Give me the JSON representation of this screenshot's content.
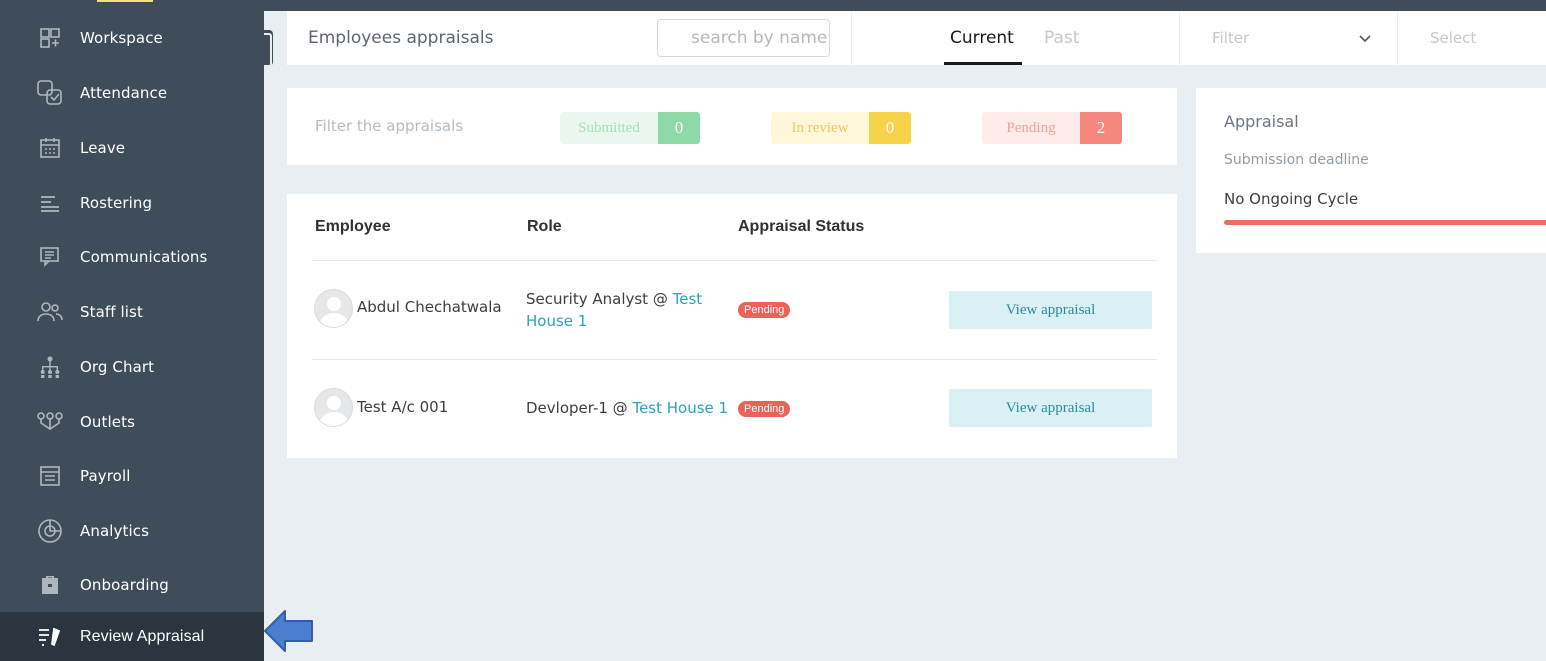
{
  "sidebar": {
    "items": [
      {
        "label": "Workspace",
        "icon": "workspace-icon"
      },
      {
        "label": "Attendance",
        "icon": "attendance-icon"
      },
      {
        "label": "Leave",
        "icon": "calendar-icon"
      },
      {
        "label": "Rostering",
        "icon": "rostering-icon"
      },
      {
        "label": "Communications",
        "icon": "communications-icon"
      },
      {
        "label": "Staff list",
        "icon": "staff-icon"
      },
      {
        "label": "Org Chart",
        "icon": "org-chart-icon"
      },
      {
        "label": "Outlets",
        "icon": "outlets-icon"
      },
      {
        "label": "Payroll",
        "icon": "payroll-icon"
      },
      {
        "label": "Analytics",
        "icon": "analytics-icon"
      },
      {
        "label": "Onboarding",
        "icon": "briefcase-icon"
      },
      {
        "label": "Review Appraisal",
        "icon": "review-appraisal-icon",
        "active": true
      }
    ]
  },
  "header": {
    "title": "Employees appraisals",
    "search_placeholder": "search by name",
    "tabs": [
      {
        "label": "Current",
        "active": true
      },
      {
        "label": "Past",
        "active": false
      }
    ],
    "filter_label": "Filter",
    "select_label": "Select"
  },
  "filters": {
    "label": "Filter the appraisals",
    "chips": [
      {
        "label": "Submitted",
        "count": "0"
      },
      {
        "label": "In review",
        "count": "0"
      },
      {
        "label": "Pending",
        "count": "2"
      }
    ]
  },
  "table": {
    "columns": [
      "Employee",
      "Role",
      "Appraisal Status"
    ],
    "rows": [
      {
        "name": "Abdul Chechatwala",
        "role": "Security Analyst @ ",
        "location": "Test House 1",
        "status": "Pending",
        "action": "View appraisal"
      },
      {
        "name": "Test A/c 001",
        "role": "Devloper-1 @ ",
        "location": "Test House 1",
        "status": "Pending",
        "action": "View appraisal"
      }
    ]
  },
  "appraisal_panel": {
    "title": "Appraisal",
    "deadline_label": "Submission deadline",
    "cycle_text": "No Ongoing Cycle"
  },
  "colors": {
    "sidebar_bg": "#3f4d5a",
    "accent_teal": "#2aa3b5",
    "pending_red": "#ea6258"
  }
}
